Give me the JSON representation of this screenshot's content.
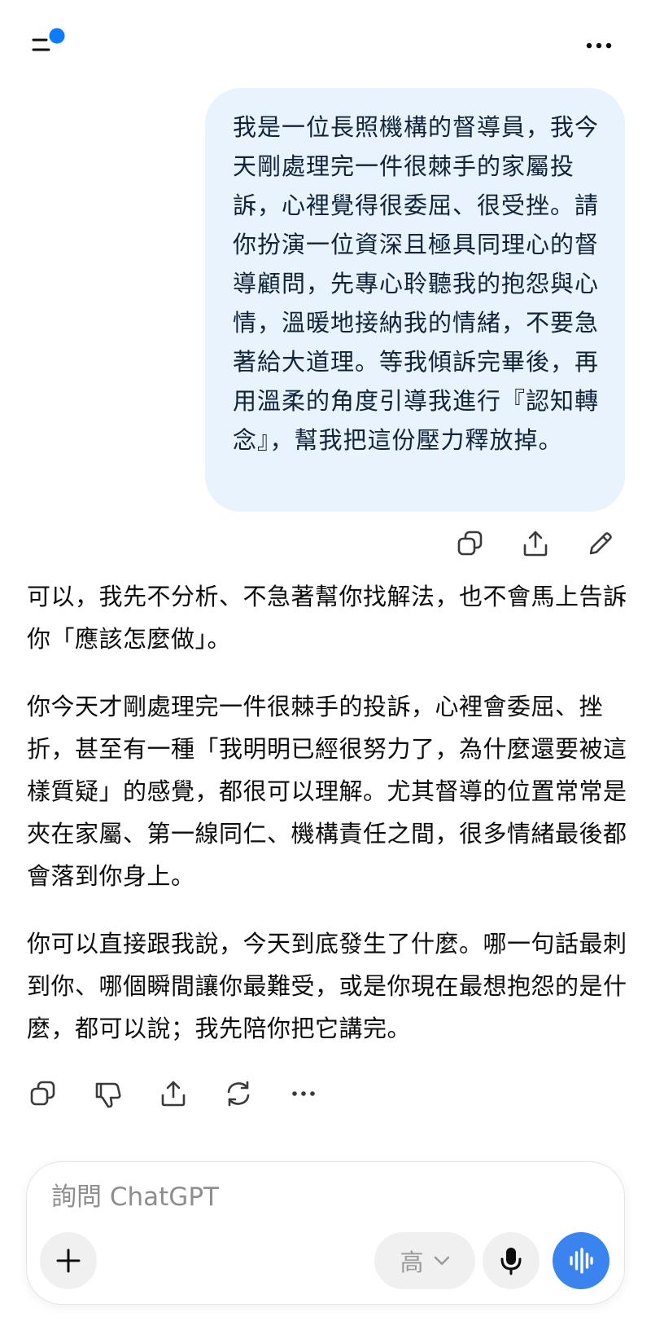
{
  "header": {
    "menu_icon": "sidebar-menu-icon",
    "more_icon": "more-horizontal-icon",
    "notification_dot_color": "#0a7cff"
  },
  "conversation": {
    "user_message": {
      "text": "我是一位長照機構的督導員，我今天剛處理完一件很棘手的家屬投訴，心裡覺得很委屈、很受挫。請你扮演一位資深且極具同理心的督導顧問，先專心聆聽我的抱怨與心情，溫暖地接納我的情緒，不要急著給大道理。等我傾訴完畢後，再用溫柔的角度引導我進行『認知轉念』，幫我把這份壓力釋放掉。",
      "actions": [
        "copy-icon",
        "share-icon",
        "edit-icon"
      ]
    },
    "assistant_message": {
      "paragraphs": [
        "可以，我先不分析、不急著幫你找解法，也不會馬上告訴你「應該怎麼做」。",
        "你今天才剛處理完一件很棘手的投訴，心裡會委屈、挫折，甚至有一種「我明明已經很努力了，為什麼還要被這樣質疑」的感覺，都很可以理解。尤其督導的位置常常是夾在家屬、第一線同仁、機構責任之間，很多情緒最後都會落到你身上。",
        "你可以直接跟我說，今天到底發生了什麼。哪一句話最刺到你、哪個瞬間讓你最難受，或是你現在最想抱怨的是什麼，都可以說；我先陪你把它講完。"
      ],
      "actions": [
        "copy-icon",
        "thumbs-down-icon",
        "share-icon",
        "regenerate-icon",
        "more-horizontal-icon"
      ]
    }
  },
  "composer": {
    "placeholder": "詢問 ChatGPT",
    "value": "",
    "effort_label": "高",
    "accent_color": "#3b84f0",
    "bubble_color": "#e8f3fe"
  }
}
